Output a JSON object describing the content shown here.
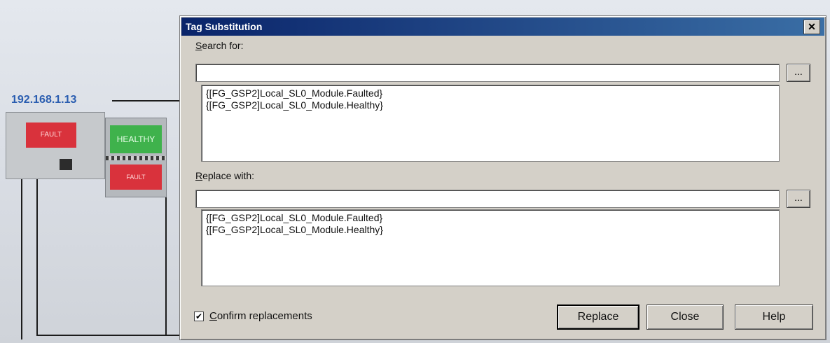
{
  "background": {
    "ip_address": "192.168.1.13",
    "power_lamp_text": "FAULT",
    "healthy_lamp_text": "HEALTHY",
    "fault_lamp_text": "FAULT"
  },
  "dialog": {
    "title": "Tag Substitution",
    "close_glyph": "✕",
    "search": {
      "label_accel": "S",
      "label_rest": "earch for:",
      "value": "",
      "browse_label": "...",
      "items": [
        "{[FG_GSP2]Local_SL0_Module.Faulted}",
        "{[FG_GSP2]Local_SL0_Module.Healthy}"
      ]
    },
    "replace": {
      "label_accel": "R",
      "label_rest": "eplace with:",
      "value": "",
      "browse_label": "...",
      "items": [
        "{[FG_GSP2]Local_SL0_Module.Faulted}",
        "{[FG_GSP2]Local_SL0_Module.Healthy}"
      ]
    },
    "confirm": {
      "checked": true,
      "check_glyph": "✔",
      "label_accel": "C",
      "label_rest": "onfirm replacements"
    },
    "buttons": {
      "replace": "Replace",
      "close": "Close",
      "help": "Help"
    }
  }
}
